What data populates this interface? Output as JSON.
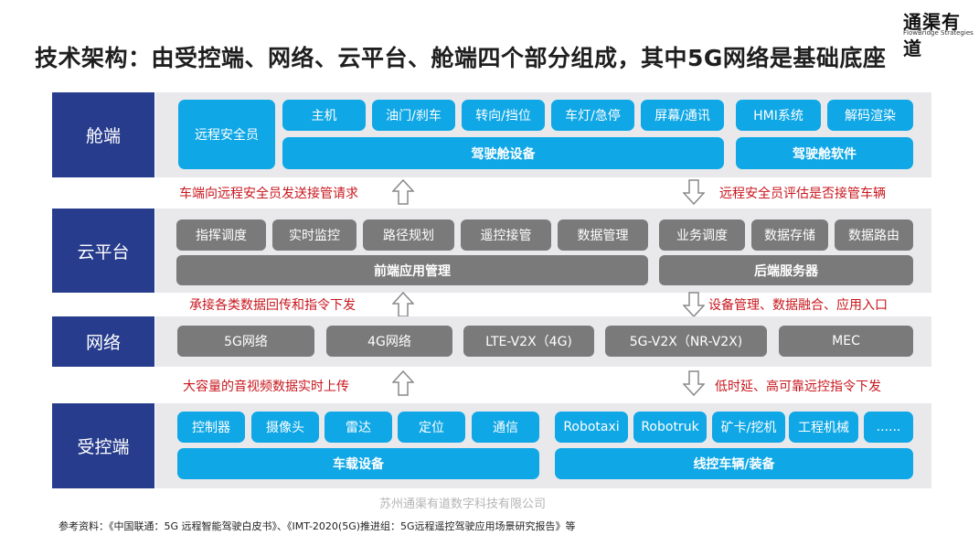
{
  "logo": {
    "cn": "通渠有道",
    "en": "FlowBridge Strategies"
  },
  "title": "技术架构：由受控端、网络、云平台、舱端四个部分组成，其中5G网络是基础底座",
  "rows": {
    "cabin": {
      "label": "舱端",
      "operator": "远程安全员",
      "devices": [
        "主机",
        "油门/刹车",
        "转向/挡位",
        "车灯/急停",
        "屏幕/通讯"
      ],
      "devices_group": "驾驶舱设备",
      "software": [
        "HMI系统",
        "解码渲染"
      ],
      "software_group": "驾驶舱软件"
    },
    "cloud": {
      "label": "云平台",
      "front": [
        "指挥调度",
        "实时监控",
        "路径规划",
        "遥控接管",
        "数据管理"
      ],
      "front_group": "前端应用管理",
      "back": [
        "业务调度",
        "数据存储",
        "数据路由"
      ],
      "back_group": "后端服务器"
    },
    "network": {
      "label": "网络",
      "items": [
        "5G网络",
        "4G网络",
        "LTE-V2X（4G)",
        "5G-V2X（NR-V2X)",
        "MEC"
      ]
    },
    "controlled": {
      "label": "受控端",
      "onboard": [
        "控制器",
        "摄像头",
        "雷达",
        "定位",
        "通信"
      ],
      "onboard_group": "车载设备",
      "vehicles": [
        "Robotaxi",
        "Robotruk",
        "矿卡/挖机",
        "工程机械",
        "......"
      ],
      "vehicles_group": "线控车辆/装备"
    }
  },
  "flows": {
    "cabin_cloud_up": "车端向远程安全员发送接管请求",
    "cabin_cloud_down": "远程安全员评估是否接管车辆",
    "cloud_net_up": "承接各类数据回传和指令下发",
    "cloud_net_down": "设备管理、数据融合、应用入口",
    "net_ctrl_up": "大容量的音视频数据实时上传",
    "net_ctrl_down": "低时延、高可靠远控指令下发"
  },
  "watermark": "苏州通渠有道数字科技有限公司",
  "reference": "参考资料：《中国联通：5G 远程智能驾驶白皮书》、《IMT-2020(5G)推进组：5G远程遥控驾驶应用场景研究报告》等",
  "colors": {
    "row_label": "#273c8c",
    "blue_box": "#0fa7e6",
    "grey_box": "#7a7a7a",
    "band": "#e9e9ec",
    "flow_text": "#c8161d"
  }
}
